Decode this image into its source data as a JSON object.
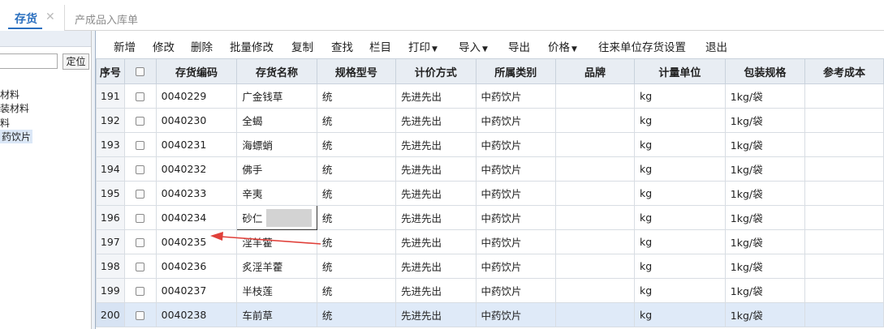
{
  "tabs": {
    "active_label": "存货",
    "close_glyph": "✕",
    "other_label": "产成品入库单"
  },
  "left_panel": {
    "locate_button": "定位",
    "tree_items": [
      "原材料",
      "包装材料",
      "辅料",
      "中药饮片"
    ],
    "tree_visible_text": [
      "材料",
      "装材料",
      "料",
      "药饮片"
    ],
    "selected_index": 3
  },
  "toolbar": {
    "new": "新增",
    "edit": "修改",
    "delete": "删除",
    "batch_edit": "批量修改",
    "copy": "复制",
    "find": "查找",
    "columns": "栏目",
    "print": "打印",
    "import": "导入",
    "export": "导出",
    "price": "价格",
    "partner_settings": "往来单位存货设置",
    "exit": "退出"
  },
  "grid": {
    "headers": [
      "序号",
      "",
      "存货编码",
      "存货名称",
      "规格型号",
      "计价方式",
      "所属类别",
      "品牌",
      "计量单位",
      "包装规格",
      "参考成本"
    ],
    "rows": [
      {
        "no": "191",
        "code": "0040229",
        "name": "广金钱草",
        "spec": "统",
        "method": "先进先出",
        "category": "中药饮片",
        "brand": "",
        "unit": "kg",
        "pack": "1kg/袋",
        "cost": ""
      },
      {
        "no": "192",
        "code": "0040230",
        "name": "全蝎",
        "spec": "统",
        "method": "先进先出",
        "category": "中药饮片",
        "brand": "",
        "unit": "kg",
        "pack": "1kg/袋",
        "cost": ""
      },
      {
        "no": "193",
        "code": "0040231",
        "name": "海螵蛸",
        "spec": "统",
        "method": "先进先出",
        "category": "中药饮片",
        "brand": "",
        "unit": "kg",
        "pack": "1kg/袋",
        "cost": ""
      },
      {
        "no": "194",
        "code": "0040232",
        "name": "佛手",
        "spec": "统",
        "method": "先进先出",
        "category": "中药饮片",
        "brand": "",
        "unit": "kg",
        "pack": "1kg/袋",
        "cost": ""
      },
      {
        "no": "195",
        "code": "0040233",
        "name": "辛夷",
        "spec": "统",
        "method": "先进先出",
        "category": "中药饮片",
        "brand": "",
        "unit": "kg",
        "pack": "1kg/袋",
        "cost": ""
      },
      {
        "no": "196",
        "code": "0040234",
        "name": "砂仁",
        "spec": "统",
        "method": "先进先出",
        "category": "中药饮片",
        "brand": "",
        "unit": "kg",
        "pack": "1kg/袋",
        "cost": ""
      },
      {
        "no": "197",
        "code": "0040235",
        "name": "淫羊藿",
        "spec": "统",
        "method": "先进先出",
        "category": "中药饮片",
        "brand": "",
        "unit": "kg",
        "pack": "1kg/袋",
        "cost": ""
      },
      {
        "no": "198",
        "code": "0040236",
        "name": "炙淫羊藿",
        "spec": "统",
        "method": "先进先出",
        "category": "中药饮片",
        "brand": "",
        "unit": "kg",
        "pack": "1kg/袋",
        "cost": ""
      },
      {
        "no": "199",
        "code": "0040237",
        "name": "半枝莲",
        "spec": "统",
        "method": "先进先出",
        "category": "中药饮片",
        "brand": "",
        "unit": "kg",
        "pack": "1kg/袋",
        "cost": ""
      },
      {
        "no": "200",
        "code": "0040238",
        "name": "车前草",
        "spec": "统",
        "method": "先进先出",
        "category": "中药饮片",
        "brand": "",
        "unit": "kg",
        "pack": "1kg/袋",
        "cost": ""
      }
    ],
    "editing_row_index": 5,
    "highlighted_row_index": 9
  },
  "annotation": {
    "arrow_color": "#e0403a"
  }
}
